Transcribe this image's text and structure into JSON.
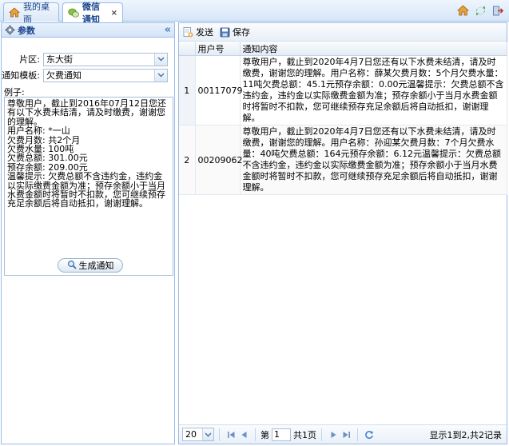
{
  "tabs": [
    {
      "label": "我的桌面",
      "icon": "house-icon"
    },
    {
      "label": "微信通知",
      "icon": "wechat-icon",
      "closable": true
    }
  ],
  "tab_close": "×",
  "left_panel": {
    "title": "参数",
    "collapse": "«",
    "district_label": "片区:",
    "district_value": "东大街",
    "template_label": "通知模板:",
    "template_value": "欠费通知",
    "example_label": "例子:",
    "example_text": "尊敬用户，截止到2016年07月12日您还有以下水费未结清，请及时缴费，谢谢您的理解。\n用户名称: *一山\n欠费月数: 共2个月\n欠费水量: 100吨\n欠费总额: 301.00元\n预存余额: 209.00元\n温馨提示: 欠费总额不含违约金，违约金以实际缴费金额为准；预存余额小于当月水费金额时将暂时不扣款，您可继续预存充足余额后将自动抵扣，谢谢理解。",
    "generate_label": "生成通知"
  },
  "toolbar": {
    "send_label": "发送",
    "save_label": "保存"
  },
  "grid": {
    "columns": [
      "用户号",
      "通知内容"
    ],
    "rows": [
      {
        "num": "1",
        "user_id": "00117079",
        "content": "尊敬用户，截止到2020年4月7日您还有以下水费未结清，请及时缴费，谢谢您的理解。用户名称：薛某欠费月数：5个月欠费水量：11吨欠费总额：45.1元预存余额：0.00元温馨提示：欠费总额不含违约金，违约金以实际缴费金额为准；预存余额小于当月水费金额时将暂时不扣款，您可继续预存充足余额后将自动抵扣，谢谢理解。"
      },
      {
        "num": "2",
        "user_id": "00209062",
        "content": "尊敬用户，截止到2020年4月7日您还有以下水费未结清，请及时缴费，谢谢您的理解。用户名称：孙迎某欠费月数：7个月欠费水量：40吨欠费总额：164元预存余额：6.12元温馨提示：欠费总额不含违约金，违约金以实际缴费金额为准；预存余额小于当月水费金额时将暂时不扣款，您可继续预存充足余额后将自动抵扣，谢谢理解。"
      }
    ]
  },
  "pager": {
    "page_size": "20",
    "page_prefix": "第",
    "page_value": "1",
    "page_suffix": "共1页",
    "info": "显示1到2,共2记录"
  }
}
